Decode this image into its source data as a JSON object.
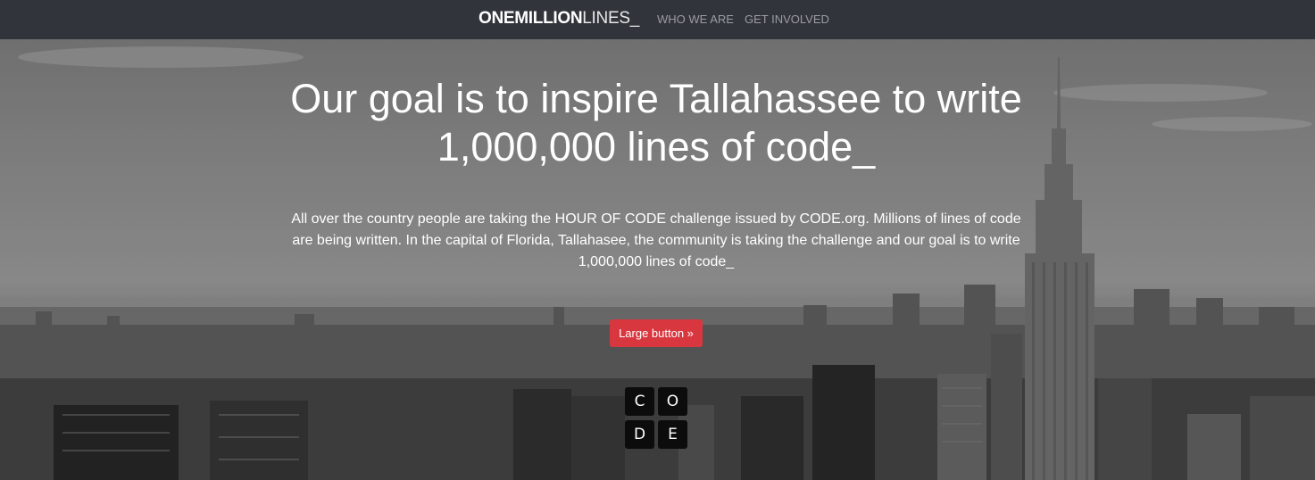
{
  "navbar": {
    "brand_bold": "ONEMILLION",
    "brand_light": "LINES_",
    "links": [
      {
        "label": "WHO WE ARE"
      },
      {
        "label": "GET INVOLVED"
      }
    ],
    "background_color": "#31343b"
  },
  "hero": {
    "headline": "Our goal is to inspire Tallahassee to write 1,000,000 lines of code_",
    "lead": "All over the country people are taking the HOUR OF CODE challenge issued by CODE.org. Millions of lines of code are being written. In the capital of Florida, Tallahasee, the community is taking the challenge and our goal is to write 1,000,000 lines of code_",
    "button_label": "Large button »",
    "button_color": "#d9373f",
    "background": "grayscale city skyline photo"
  },
  "code_logo": {
    "letters": [
      "C",
      "O",
      "D",
      "E"
    ]
  }
}
